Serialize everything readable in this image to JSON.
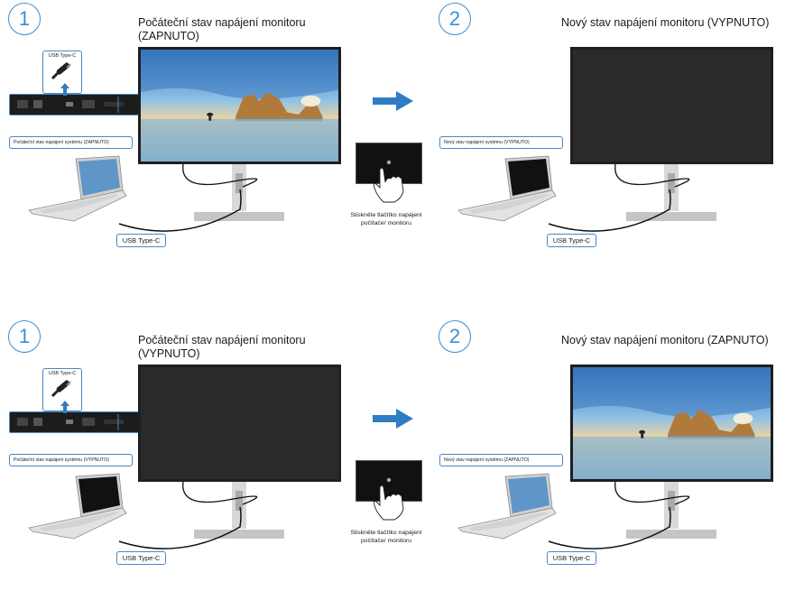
{
  "colors": {
    "accent": "#3a8fd0",
    "callout_border": "#4a86c5",
    "screen_off": "#2a2a2a",
    "arrow": "#2e7cc4"
  },
  "rows": [
    {
      "step1": "1",
      "step2": "2",
      "title1": "Počáteční stav napájení monitoru (ZAPNUTO)",
      "title2": "Nový stav napájení monitoru (VYPNUTO)",
      "usb_zoom_label": "USB Type-C",
      "callout1": "Počáteční stav napájení systému (ZAPNUTO)",
      "callout2": "Nový stav napájení systému (VYPNUTO)",
      "usb_label1": "USB Type-C",
      "usb_label2": "USB Type-C",
      "press_text": "Stiskněte tlačítko napájení počítače/ monitoru",
      "monitor1_screen": "on",
      "monitor2_screen": "off",
      "laptop1_screen": "on",
      "laptop2_screen": "off"
    },
    {
      "step1": "1",
      "step2": "2",
      "title1": "Počáteční stav napájení monitoru (VYPNUTO)",
      "title2": "Nový stav napájení monitoru (ZAPNUTO)",
      "usb_zoom_label": "USB Type-C",
      "callout1": "Počáteční stav napájení systému (VYPNUTO)",
      "callout2": "Nový stav napájení systému (ZAPNUTO)",
      "usb_label1": "USB Type-C",
      "usb_label2": "USB Type-C",
      "press_text": "Stiskněte tlačítko napájení počítače/ monitoru",
      "monitor1_screen": "off",
      "monitor2_screen": "on",
      "laptop1_screen": "off",
      "laptop2_screen": "on"
    }
  ]
}
